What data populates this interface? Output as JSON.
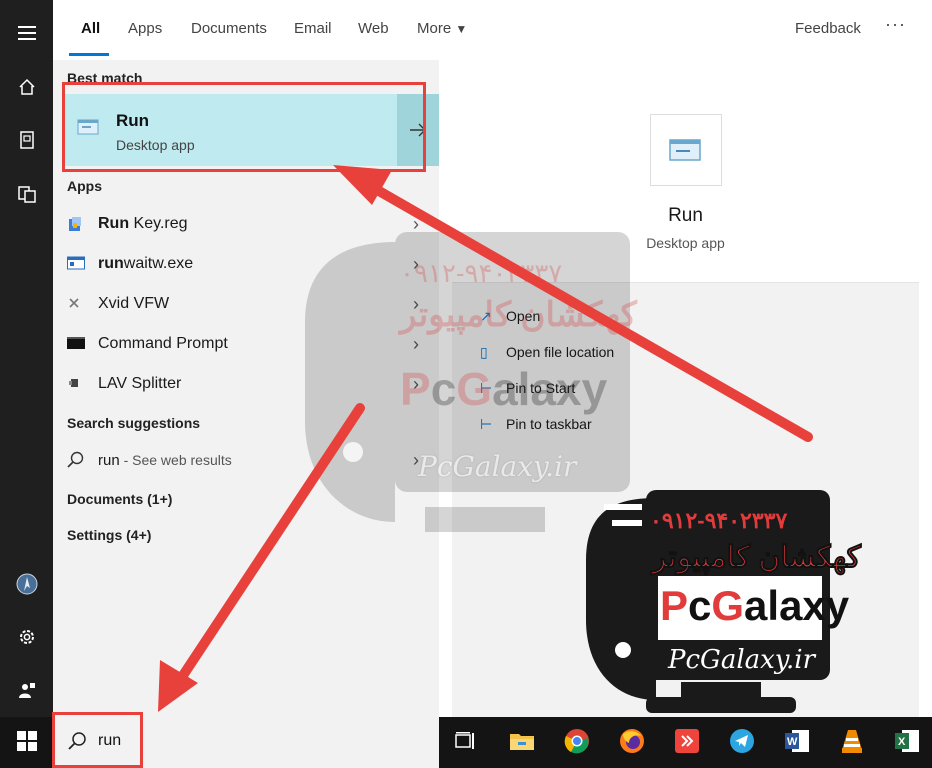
{
  "tabs": {
    "all": "All",
    "apps": "Apps",
    "documents": "Documents",
    "email": "Email",
    "web": "Web",
    "more": "More",
    "feedback": "Feedback",
    "ellipsis": "···"
  },
  "sections": {
    "best_match": "Best match",
    "apps": "Apps",
    "search_suggestions": "Search suggestions",
    "documents": "Documents (1+)",
    "settings": "Settings (4+)"
  },
  "best_match": {
    "title": "Run",
    "subtitle": "Desktop app"
  },
  "apps": [
    {
      "bold": "Run",
      "rest": " Key.reg"
    },
    {
      "bold": "run",
      "rest": "waitw.exe"
    },
    {
      "bold": "",
      "rest": "Xvid VFW"
    },
    {
      "bold": "",
      "rest": "Command Prompt"
    },
    {
      "bold": "",
      "rest": "LAV Splitter"
    }
  ],
  "suggestion": {
    "query": "run",
    "hint": " - See web results"
  },
  "detail": {
    "title": "Run",
    "subtitle": "Desktop app",
    "actions": [
      "Open",
      "Open file location",
      "Pin to Start",
      "Pin to taskbar"
    ]
  },
  "search": {
    "value": "run"
  },
  "watermark": {
    "phone": "۰۹۱۲-۹۴۰۲۳۳۷",
    "persian": "کهکشان کامپیوتر",
    "brand_p": "P",
    "brand_c": "c",
    "brand_g": "G",
    "brand_rest": "alaxy",
    "site": "PcGalaxy.ir"
  },
  "colors": {
    "accent": "#0078d7",
    "best_bg": "#bfeaef",
    "annotation_red": "#e8413c"
  }
}
